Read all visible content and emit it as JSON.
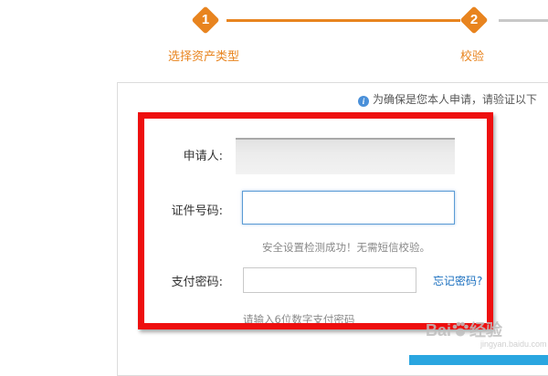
{
  "steps": [
    {
      "number": "1",
      "label": "选择资产类型",
      "state": "done"
    },
    {
      "number": "2",
      "label": "校验",
      "state": "active"
    }
  ],
  "notice": {
    "icon": "info-icon",
    "text": "为确保是您本人申请，请验证以下"
  },
  "form": {
    "applicant_label": "申请人:",
    "applicant_value": "",
    "id_label": "证件号码:",
    "id_value": "",
    "id_hint": "安全设置检测成功！无需短信校验。",
    "pay_label": "支付密码:",
    "pay_value": "",
    "forgot_link": "忘记密码?",
    "pay_hint": "请输入6位数字支付密码"
  },
  "watermark": {
    "text": "Bai",
    "text2": "经验",
    "sub": "jingyan.baidu.com"
  },
  "colors": {
    "accent": "#e8841f",
    "highlight": "#ee0f0f",
    "link": "#1a6fbf",
    "submit": "#2aa6e0"
  }
}
